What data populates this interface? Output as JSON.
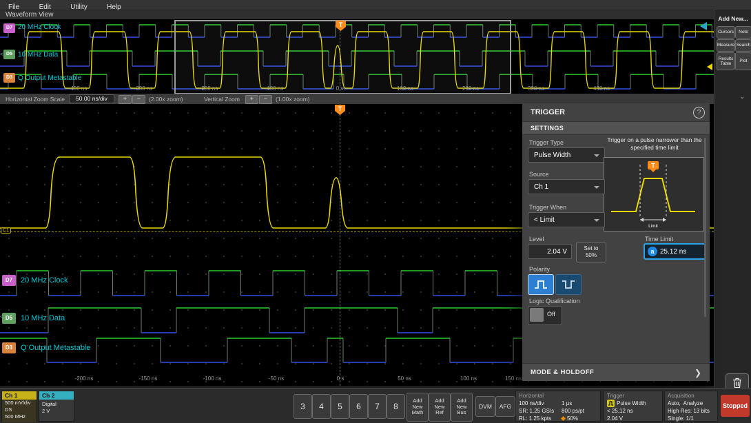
{
  "menu": {
    "items": [
      {
        "label": "File"
      },
      {
        "label": "Edit"
      },
      {
        "label": "Utility"
      },
      {
        "label": "Help"
      }
    ]
  },
  "view": {
    "title": "Waveform View"
  },
  "add_new": {
    "title": "Add New...",
    "cursors": "Cursors",
    "note": "Note",
    "measure": "Measure",
    "search": "Search",
    "results_table": "Results Table",
    "plot": "Plot"
  },
  "channels": {
    "d7": {
      "id": "D7",
      "label": "20 MHz Clock"
    },
    "d5": {
      "id": "D5",
      "label": "10 MHz Data"
    },
    "d3": {
      "id": "D3",
      "label": "Q Output Metastable"
    }
  },
  "overview_axis": {
    "t0": "-400 ns",
    "t1": "-300 ns",
    "t2": "-200 ns",
    "t3": "-100 ns",
    "t4": "0 s",
    "t5": "100 ns",
    "t6": "200 ns",
    "t7": "300 ns",
    "t8": "400 ns"
  },
  "main_axis": {
    "t0": "-200 ns",
    "t1": "-150 ns",
    "t2": "-100 ns",
    "t3": "-50 ns",
    "t4": "0 s",
    "t5": "50 ns",
    "t6": "100 ns",
    "t7": "150 ns"
  },
  "zoom_bar": {
    "h_label": "Horizontal Zoom Scale",
    "h_scale": "50.00 ns/div",
    "h_factor": "(2.00x zoom)",
    "v_label": "Vertical Zoom",
    "v_factor": "(1.00x zoom)"
  },
  "trigger_marker": "T",
  "level_marker": "C1",
  "trigger_panel": {
    "title": "TRIGGER",
    "tab": "SETTINGS",
    "type_label": "Trigger Type",
    "type_value": "Pulse Width",
    "description": "Trigger on a pulse narrower than the specified time limit",
    "source_label": "Source",
    "source_value": "Ch 1",
    "when_label": "Trigger When",
    "when_value": "< Limit",
    "level_label": "Level",
    "level_value": "2.04 V",
    "set_to_l1": "Set to",
    "set_to_l2": "50%",
    "time_limit_label": "Time Limit",
    "time_limit_value": "25.12 ns",
    "knob": "a",
    "polarity_label": "Polarity",
    "logic_label": "Logic Qualification",
    "logic_value": "Off",
    "graphic_caption": "Limit",
    "mode_holdoff": "MODE & HOLDOFF"
  },
  "badges": {
    "ch1": {
      "name": "Ch 1",
      "line1": "500 mV/div",
      "line2": "DS",
      "line3": "500 MHz"
    },
    "ch2": {
      "name": "Ch 2",
      "line1": "Digital",
      "line2": "2 V"
    }
  },
  "inactive_channels": {
    "c3": "3",
    "c4": "4",
    "c5": "5",
    "c6": "6",
    "c7": "7",
    "c8": "8"
  },
  "add_buttons": {
    "math": {
      "l1": "Add",
      "l2": "New",
      "l3": "Math"
    },
    "ref": {
      "l1": "Add",
      "l2": "New",
      "l3": "Ref"
    },
    "bus": {
      "l1": "Add",
      "l2": "New",
      "l3": "Bus"
    }
  },
  "dvm": "DVM",
  "afg": "AFG",
  "horizontal": {
    "title": "Horizontal",
    "r1c1": "100 ns/div",
    "r1c2": "1 μs",
    "r2c1": "SR: 1.25 GS/s",
    "r2c2": "800 ps/pt",
    "r3c1": "RL: 1.25 kpts",
    "r3c2": "50%"
  },
  "trigger_badge": {
    "title": "Trigger",
    "r1": "Pulse Width",
    "r2": "< 25.12 ns",
    "r3": "2.04 V"
  },
  "acquisition": {
    "title": "Acquisition",
    "r1": "Auto,  Analyze",
    "r2": "High Res: 13 bits",
    "r3": "Single: 1/1"
  },
  "run_state": "Stopped",
  "icons": {
    "plus": "+",
    "minus": "−",
    "help": "?",
    "chevron_right": "❯",
    "chevron_down": "⌄",
    "handle": "<>"
  },
  "colors": {
    "analog": "#e8d800",
    "dig_high": "#2ecc2e",
    "dig_low": "#3050e8",
    "accent_blue": "#2aa3e8",
    "trigger_orange": "#ff8c1a",
    "label_cyan": "#00c8d8"
  }
}
